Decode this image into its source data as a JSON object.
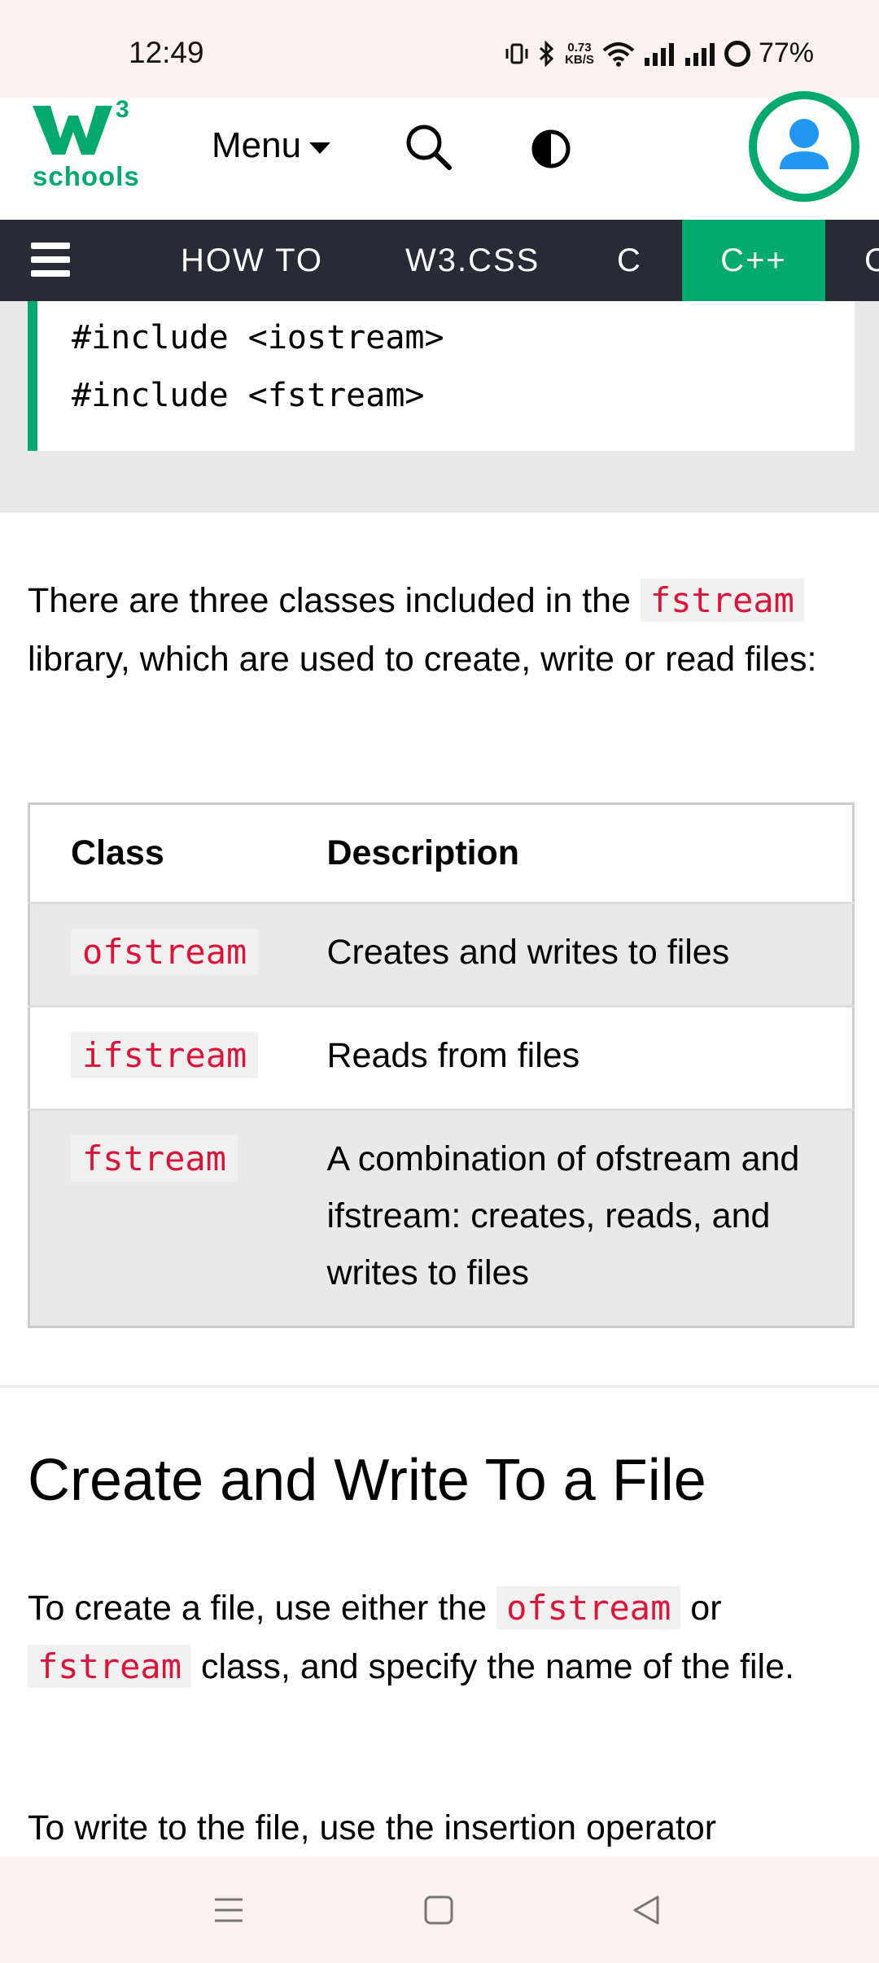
{
  "status_bar": {
    "time": "12:49",
    "net_speed_value": "0.73",
    "net_speed_unit": "KB/S",
    "battery": "77%"
  },
  "header": {
    "logo_text": "schools",
    "logo_mark": "W",
    "logo_superscript": "3",
    "menu_label": "Menu"
  },
  "nav": {
    "items": [
      {
        "label": "HOW TO"
      },
      {
        "label": "W3.CSS"
      },
      {
        "label": "C"
      },
      {
        "label": "C++"
      },
      {
        "label": "C"
      }
    ],
    "active_index": 3
  },
  "code_block": {
    "lines": [
      "#include <iostream>",
      "#include <fstream>"
    ]
  },
  "intro": {
    "text_before": "There are three classes included in the ",
    "code": "fstream",
    "text_after": " library, which are used to create, write or read files:"
  },
  "table": {
    "headers": [
      "Class",
      "Description"
    ],
    "rows": [
      {
        "class": "ofstream",
        "description": "Creates and writes to files"
      },
      {
        "class": "ifstream",
        "description": "Reads from files"
      },
      {
        "class": "fstream",
        "description": "A combination of ofstream and ifstream: creates, reads, and writes to files"
      }
    ]
  },
  "section": {
    "heading": "Create and Write To a File",
    "para1_a": "To create a file, use either the ",
    "para1_code1": "ofstream",
    "para1_b": " or ",
    "para1_code2": "fstream",
    "para1_c": " class, and specify the name of the file.",
    "para2": "To write to the file, use the insertion operator"
  },
  "colors": {
    "brand_green": "#04aa6d",
    "nav_dark": "#282a35",
    "code_red": "#dc143c"
  }
}
